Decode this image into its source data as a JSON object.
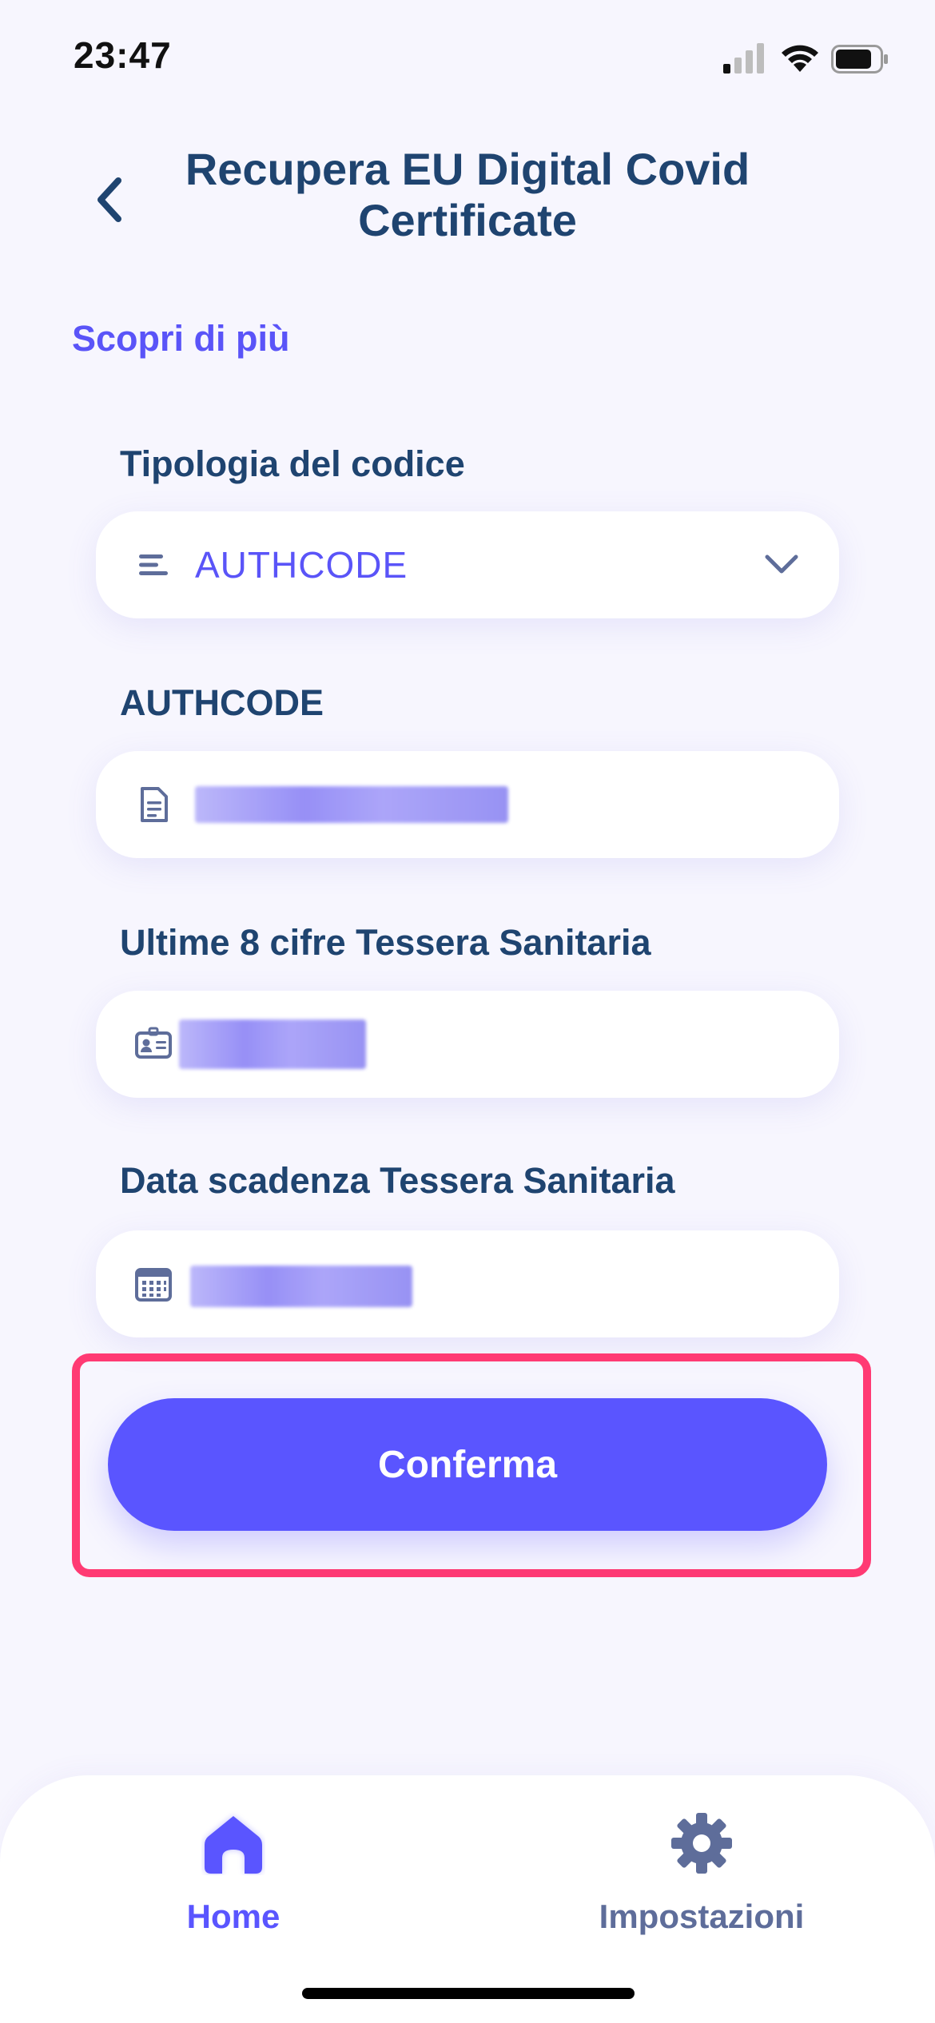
{
  "status_bar": {
    "time": "23:47"
  },
  "header": {
    "title": "Recupera EU Digital Covid Certificate"
  },
  "learn_more": "Scopri di più",
  "code_type": {
    "label": "Tipologia del codice",
    "value": "AUTHCODE"
  },
  "authcode": {
    "label": "AUTHCODE"
  },
  "health_card": {
    "label": "Ultime 8 cifre Tessera Sanitaria"
  },
  "expiry": {
    "label": "Data scadenza Tessera Sanitaria"
  },
  "confirm_button": "Conferma",
  "tab_bar": {
    "items": [
      {
        "label": "Home",
        "icon": "home-icon",
        "active": true
      },
      {
        "label": "Impostazioni",
        "icon": "gear-icon",
        "active": false
      }
    ]
  },
  "colors": {
    "accent": "#5A55FF",
    "text_primary": "#1F4470",
    "highlight": "#FF3A73",
    "inactive_tab": "#5E6D9A"
  }
}
